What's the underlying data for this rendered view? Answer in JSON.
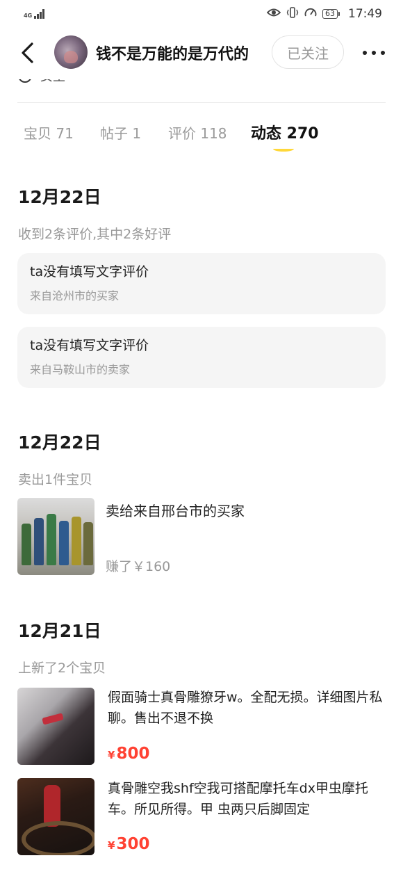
{
  "status_bar": {
    "network": "4G",
    "battery": "63",
    "time": "17:49"
  },
  "header": {
    "shop_name": "钱不是万能的是万代的",
    "follow_label": "已关注",
    "gender_text": "女生"
  },
  "tabs": [
    {
      "label": "宝贝 71",
      "active": false
    },
    {
      "label": "帖子 1",
      "active": false
    },
    {
      "label": "评价 118",
      "active": false
    },
    {
      "label": "动态 270",
      "active": true
    }
  ],
  "feed": {
    "group1": {
      "date": "12月22日",
      "summary": "收到2条评价,其中2条好评",
      "reviews": [
        {
          "text": "ta没有填写文字评价",
          "from": "来自沧州市的买家"
        },
        {
          "text": "ta没有填写文字评价",
          "from": "来自马鞍山市的卖家"
        }
      ]
    },
    "group2": {
      "date": "12月22日",
      "summary": "卖出1件宝贝",
      "sold_to": "卖给来自邢台市的买家",
      "earned": "赚了￥160"
    },
    "group3": {
      "date": "12月21日",
      "summary": "上新了2个宝贝",
      "items": [
        {
          "desc": "假面骑士真骨雕獠牙w。全配无损。详细图片私聊。售出不退不换",
          "currency": "¥",
          "price": "800"
        },
        {
          "desc": "真骨雕空我shf空我可搭配摩托车dx甲虫摩托车。所见所得。甲 虫两只后脚固定",
          "currency": "¥",
          "price": "300"
        }
      ]
    }
  },
  "colors": {
    "accent_yellow": "#ffd83a",
    "price_red": "#ff4233",
    "card_bg": "#f5f5f5"
  },
  "icons": [
    "back-arrow-icon",
    "more-icon",
    "gender-icon",
    "eye-icon",
    "vibrate-icon",
    "speedometer-icon"
  ]
}
